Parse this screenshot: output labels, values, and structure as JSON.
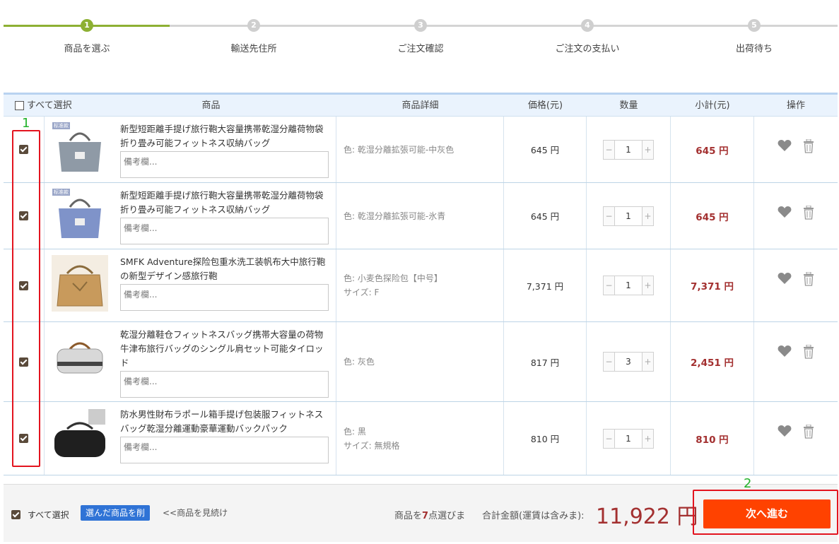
{
  "steps": [
    {
      "num": "1",
      "label": "商品を選ぶ",
      "active": true
    },
    {
      "num": "2",
      "label": "輸送先住所",
      "active": false
    },
    {
      "num": "3",
      "label": "ご注文確認",
      "active": false
    },
    {
      "num": "4",
      "label": "ご注文の支払い",
      "active": false
    },
    {
      "num": "5",
      "label": "出荷待ち",
      "active": false
    }
  ],
  "table": {
    "headers": {
      "select_all": "すべて選択",
      "product": "商品",
      "detail": "商品詳細",
      "price": "価格(元)",
      "qty": "数量",
      "subtotal": "小計(元)",
      "ops": "操作"
    },
    "note_placeholder": "備考欄...",
    "rows": [
      {
        "title": "新型短距離手提げ旅行鞄大容量携帯乾湿分離荷物袋折り畳み可能フィットネス収納バッグ",
        "tag": "标准款",
        "detail1": "色: 乾湿分離拡張可能-中灰色",
        "detail2": "",
        "price": "645 円",
        "qty": "1",
        "subtotal": "645 円",
        "bag_color": "#8f9aa6"
      },
      {
        "title": "新型短距離手提げ旅行鞄大容量携帯乾湿分離荷物袋折り畳み可能フィットネス収納バッグ",
        "tag": "标准款",
        "detail1": "色: 乾湿分離拡張可能-氷青",
        "detail2": "",
        "price": "645 円",
        "qty": "1",
        "subtotal": "645 円",
        "bag_color": "#7f93c9"
      },
      {
        "title": "SMFK Adventure探险包重水洗工装帆布大中旅行鞄の新型デザイン感旅行鞄",
        "tag": "",
        "detail1": "色: 小麦色探险包【中号】",
        "detail2": "サイズ: F",
        "price": "7,371 円",
        "qty": "1",
        "subtotal": "7,371 円",
        "bag_color": "#c89a5c"
      },
      {
        "title": "乾湿分離鞋仓フィットネスバッグ携帯大容量の荷物牛津布旅行バッグのシングル肩セット可能タイロッド",
        "tag": "",
        "detail1": "色: 灰色",
        "detail2": "",
        "price": "817 円",
        "qty": "3",
        "subtotal": "2,451 円",
        "bag_color": "#d8d8d8"
      },
      {
        "title": "防水男性財布ラポール箱手提げ包装服フィットネスバッグ乾湿分離運動豪華運動バックパック",
        "tag": "",
        "detail1": "色: 黒",
        "detail2": "サイズ: 無規格",
        "price": "810 円",
        "qty": "1",
        "subtotal": "810 円",
        "bag_color": "#1f1f1f"
      }
    ]
  },
  "annotations": {
    "n1": "1",
    "n2": "2"
  },
  "footer": {
    "select_all": "すべて選択",
    "delete_selected": "選んだ商品を削",
    "continue_shopping": "<<商品を見続け",
    "count_prefix": "商品を",
    "count_value": "7",
    "count_suffix": "点選びま",
    "total_label": "合計金額(運賃は含みま):",
    "total_value": "11,922 円",
    "next_button": "次へ進む"
  },
  "colors": {
    "accent_green": "#8db033",
    "price_red": "#a33030",
    "next_orange": "#ff4200",
    "annotation_red": "#e3141f",
    "annotation_green": "#22b22a"
  }
}
